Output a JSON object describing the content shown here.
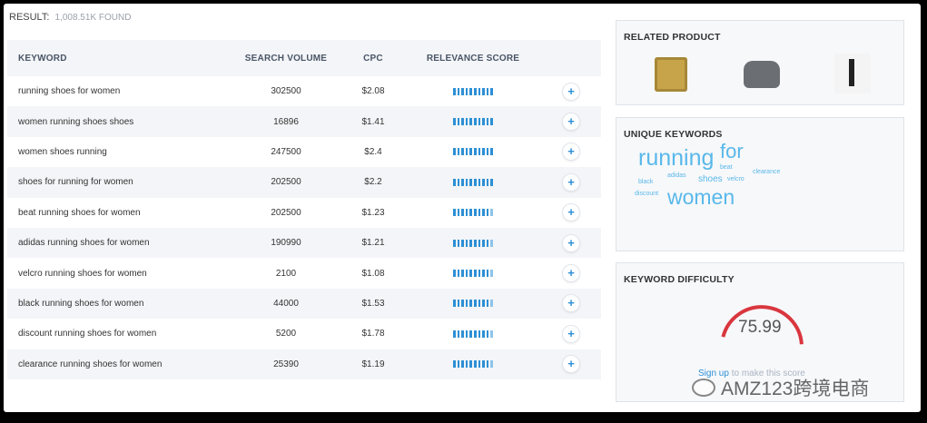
{
  "result": {
    "label": "RESULT:",
    "count": "1,008.51K FOUND"
  },
  "table": {
    "headers": [
      "KEYWORD",
      "SEARCH VOLUME",
      "CPC",
      "RELEVANCE SCORE"
    ],
    "add_glyph": "+",
    "rows": [
      {
        "keyword": "running shoes for women",
        "volume": "302500",
        "cpc": "$2.08",
        "relevance": 1.0
      },
      {
        "keyword": "women running shoes shoes",
        "volume": "16896",
        "cpc": "$1.41",
        "relevance": 1.0
      },
      {
        "keyword": "women shoes running",
        "volume": "247500",
        "cpc": "$2.4",
        "relevance": 1.0
      },
      {
        "keyword": "shoes for running for women",
        "volume": "202500",
        "cpc": "$2.2",
        "relevance": 1.0
      },
      {
        "keyword": "beat running shoes for women",
        "volume": "202500",
        "cpc": "$1.23",
        "relevance": 0.9
      },
      {
        "keyword": "adidas running shoes for women",
        "volume": "190990",
        "cpc": "$1.21",
        "relevance": 0.9
      },
      {
        "keyword": "velcro running shoes for women",
        "volume": "2100",
        "cpc": "$1.08",
        "relevance": 0.9
      },
      {
        "keyword": "black running shoes for women",
        "volume": "44000",
        "cpc": "$1.53",
        "relevance": 0.9
      },
      {
        "keyword": "discount running shoes for women",
        "volume": "5200",
        "cpc": "$1.78",
        "relevance": 0.9
      },
      {
        "keyword": "clearance running shoes for women",
        "volume": "25390",
        "cpc": "$1.19",
        "relevance": 0.9
      }
    ]
  },
  "related_product": {
    "title": "RELATED PRODUCT"
  },
  "unique_keywords": {
    "title": "UNIQUE KEYWORDS",
    "words": [
      "running",
      "for",
      "women",
      "shoes",
      "adidas",
      "beat",
      "velcro",
      "black",
      "discount",
      "clearance"
    ]
  },
  "keyword_difficulty": {
    "title": "KEYWORD DIFFICULTY",
    "value": "75.99",
    "score": 75.99,
    "signup_link": "Sign up",
    "signup_rest": "to make this score"
  },
  "watermark": "AMZ123跨境电商",
  "colors": {
    "accent": "#2d8fd5",
    "cloud": "#59b8ea",
    "gauge": "#d9363e"
  }
}
